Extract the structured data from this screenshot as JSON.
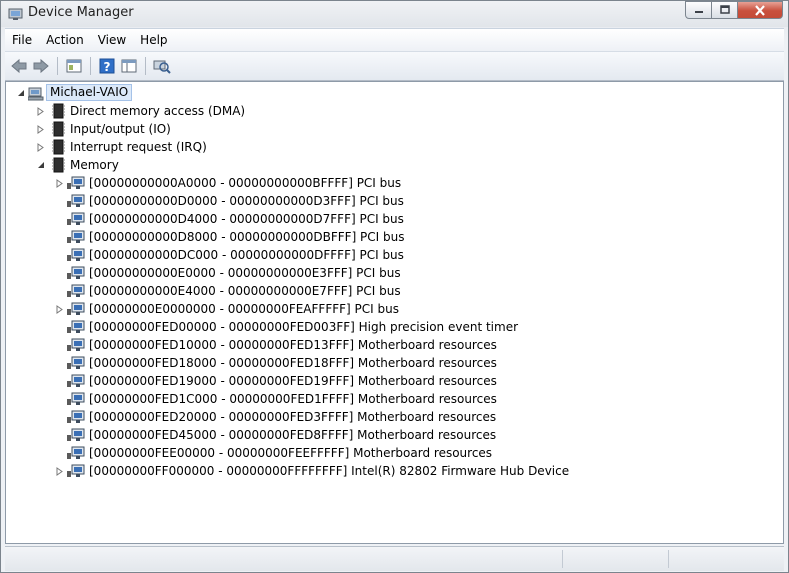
{
  "window": {
    "title": "Device Manager"
  },
  "menu": {
    "items": [
      "File",
      "Action",
      "View",
      "Help"
    ]
  },
  "toolbar": {
    "buttons": [
      "back-icon",
      "forward-icon",
      "properties-view-icon",
      "help-icon",
      "show-hide-tree-icon",
      "scan-hardware-icon"
    ]
  },
  "tree": {
    "root": "Michael-VAIO",
    "categories": [
      {
        "label": "Direct memory access (DMA)",
        "expanded": false
      },
      {
        "label": "Input/output (IO)",
        "expanded": false
      },
      {
        "label": "Interrupt request (IRQ)",
        "expanded": false
      },
      {
        "label": "Memory",
        "expanded": true
      }
    ],
    "memory_items": [
      {
        "label": "[00000000000A0000 - 00000000000BFFFF]  PCI bus",
        "has_children": true
      },
      {
        "label": "[00000000000D0000 - 00000000000D3FFF]  PCI bus",
        "has_children": false
      },
      {
        "label": "[00000000000D4000 - 00000000000D7FFF]  PCI bus",
        "has_children": false
      },
      {
        "label": "[00000000000D8000 - 00000000000DBFFF]  PCI bus",
        "has_children": false
      },
      {
        "label": "[00000000000DC000 - 00000000000DFFFF]  PCI bus",
        "has_children": false
      },
      {
        "label": "[00000000000E0000 - 00000000000E3FFF]  PCI bus",
        "has_children": false
      },
      {
        "label": "[00000000000E4000 - 00000000000E7FFF]  PCI bus",
        "has_children": false
      },
      {
        "label": "[00000000E0000000 - 00000000FEAFFFFF]  PCI bus",
        "has_children": true
      },
      {
        "label": "[00000000FED00000 - 00000000FED003FF]  High precision event timer",
        "has_children": false
      },
      {
        "label": "[00000000FED10000 - 00000000FED13FFF]  Motherboard resources",
        "has_children": false
      },
      {
        "label": "[00000000FED18000 - 00000000FED18FFF]  Motherboard resources",
        "has_children": false
      },
      {
        "label": "[00000000FED19000 - 00000000FED19FFF]  Motherboard resources",
        "has_children": false
      },
      {
        "label": "[00000000FED1C000 - 00000000FED1FFFF]  Motherboard resources",
        "has_children": false
      },
      {
        "label": "[00000000FED20000 - 00000000FED3FFFF]  Motherboard resources",
        "has_children": false
      },
      {
        "label": "[00000000FED45000 - 00000000FED8FFFF]  Motherboard resources",
        "has_children": false
      },
      {
        "label": "[00000000FEE00000 - 00000000FEEFFFFF]  Motherboard resources",
        "has_children": false
      },
      {
        "label": "[00000000FF000000 - 00000000FFFFFFFF]  Intel(R) 82802 Firmware Hub Device",
        "has_children": true
      }
    ]
  },
  "colors": {
    "selection": "#dce9f9",
    "close_button": "#c9503d"
  }
}
